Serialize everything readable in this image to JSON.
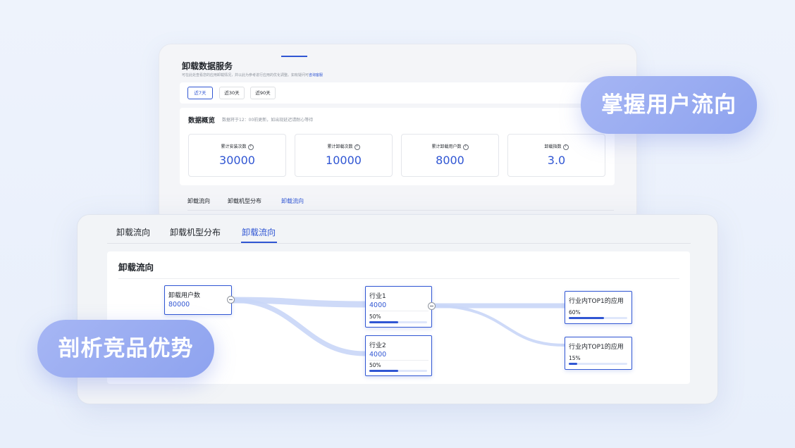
{
  "back_card": {
    "title": "卸载数据服务",
    "subtitle": "可在此处查看您的应用卸载情况，并以此为参考进行应用的优化调整。如有疑问可",
    "subtitle_link": "咨询客服",
    "ranges": [
      "近7天",
      "近30天",
      "近90天"
    ],
    "active_range": "近7天",
    "overview_title": "数据概览",
    "overview_note": "数据将于12：00前更新，如出现延迟请耐心等待",
    "metrics": [
      {
        "label": "累计安装次数",
        "value": "30000"
      },
      {
        "label": "累计卸载次数",
        "value": "10000"
      },
      {
        "label": "累计卸载用户数",
        "value": "8000"
      },
      {
        "label": "卸载指数",
        "value": "3.0"
      }
    ],
    "tabs": [
      "卸载流向",
      "卸载机型分布",
      "卸载流向"
    ],
    "active_tab_index": 2
  },
  "front_card": {
    "tabs": [
      "卸载流向",
      "卸载机型分布",
      "卸载流向"
    ],
    "active_tab_index": 2,
    "panel_title": "卸载流向",
    "nodes": {
      "root": {
        "label": "卸载用户数",
        "value": "80000"
      },
      "industry1": {
        "label": "行业1",
        "value": "4000",
        "percent_text": "50%",
        "percent": 0.5
      },
      "industry2": {
        "label": "行业2",
        "value": "4000",
        "percent_text": "50%",
        "percent": 0.5
      },
      "app1": {
        "label": "行业内TOP1的应用",
        "percent_text": "60%",
        "percent": 0.6
      },
      "app2": {
        "label": "行业内TOP1的应用",
        "percent_text": "15%",
        "percent": 0.15
      }
    }
  },
  "badges": {
    "top": "掌握用户流向",
    "bottom": "剖析竞品优势"
  },
  "colors": {
    "accent": "#3056d3",
    "badge": "#9aacf2",
    "flow": "#c9d6f7"
  }
}
